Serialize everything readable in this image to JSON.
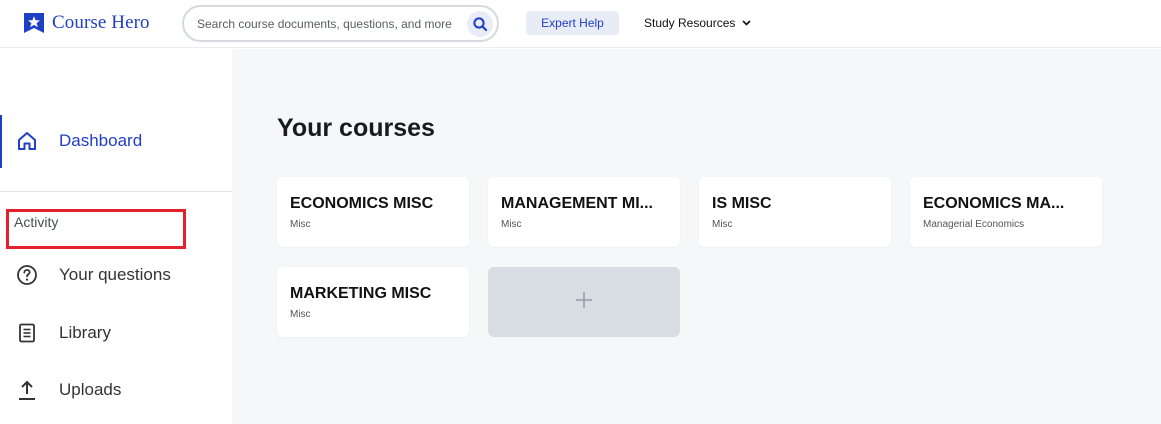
{
  "header": {
    "logo_text": "Course Hero",
    "search_placeholder": "Search course documents, questions, and more",
    "expert_help": "Expert Help",
    "study_resources": "Study Resources"
  },
  "sidebar": {
    "dashboard": "Dashboard",
    "section_activity": "Activity",
    "items": [
      {
        "label": "Your questions",
        "icon": "question-circle-icon"
      },
      {
        "label": "Library",
        "icon": "document-icon"
      },
      {
        "label": "Uploads",
        "icon": "upload-arrow-icon"
      }
    ]
  },
  "main": {
    "title": "Your courses",
    "courses": [
      {
        "title": "ECONOMICS MISC",
        "subtitle": "Misc"
      },
      {
        "title": "MANAGEMENT MI...",
        "subtitle": "Misc"
      },
      {
        "title": "IS MISC",
        "subtitle": "Misc"
      },
      {
        "title": "ECONOMICS MA...",
        "subtitle": "Managerial Economics"
      },
      {
        "title": "MARKETING MISC",
        "subtitle": "Misc"
      }
    ]
  },
  "colors": {
    "brand_blue": "#1f3fc4",
    "highlight_red": "#e3212d",
    "main_bg": "#f6f7f9",
    "add_card_bg": "#d8dde4"
  }
}
